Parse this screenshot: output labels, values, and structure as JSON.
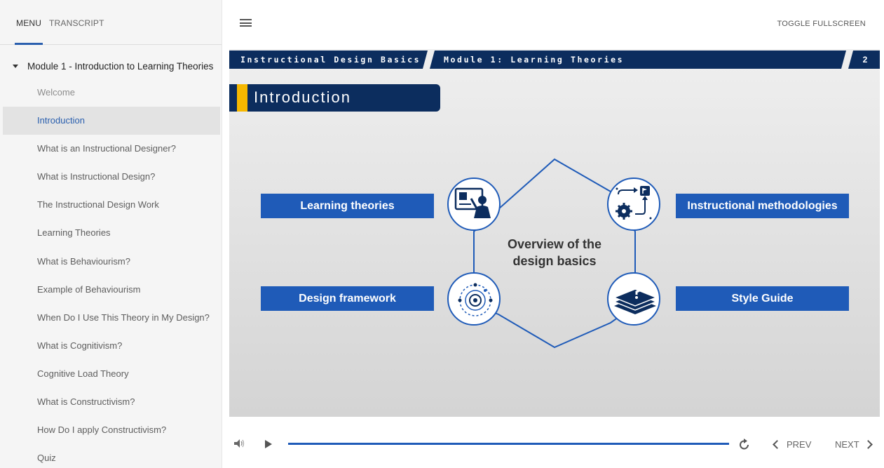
{
  "sidebar": {
    "tabs": {
      "menu": "MENU",
      "transcript": "TRANSCRIPT"
    },
    "module": "Module 1 - Introduction to Learning Theories",
    "lessons": [
      "Welcome",
      "Introduction",
      "What is an Instructional Designer?",
      "What is Instructional Design?",
      "The Instructional Design Work",
      "Learning Theories",
      "What is Behaviourism?",
      "Example of Behaviourism",
      "When Do I Use This Theory in My Design?",
      "What is Cognitivism?",
      "Cognitive Load Theory",
      "What is Constructivism?",
      "How Do I apply Constructivism?",
      "Quiz"
    ],
    "active_index": 1
  },
  "topbar": {
    "toggle_fullscreen": "TOGGLE FULLSCREEN"
  },
  "slide": {
    "breadcrumb_course": "Instructional Design Basics",
    "breadcrumb_module": "Module 1: Learning Theories",
    "page_number": "2",
    "title": "Introduction",
    "center_text_line1": "Overview of the",
    "center_text_line2": "design basics",
    "labels": {
      "learning": "Learning theories",
      "instructional": "Instructional methodologies",
      "framework": "Design framework",
      "style": "Style Guide"
    },
    "icons": {
      "learning": "teacher-board-icon",
      "instructional": "workflow-gear-flag-icon",
      "framework": "target-framework-icon",
      "style": "question-books-icon"
    }
  },
  "controls": {
    "prev": "PREV",
    "next": "NEXT",
    "progress": 1.0
  },
  "colors": {
    "navy": "#0c2d5e",
    "blue": "#1f5bb8",
    "accent_yellow": "#f6b800",
    "sidebar_active_text": "#2a5fae"
  }
}
